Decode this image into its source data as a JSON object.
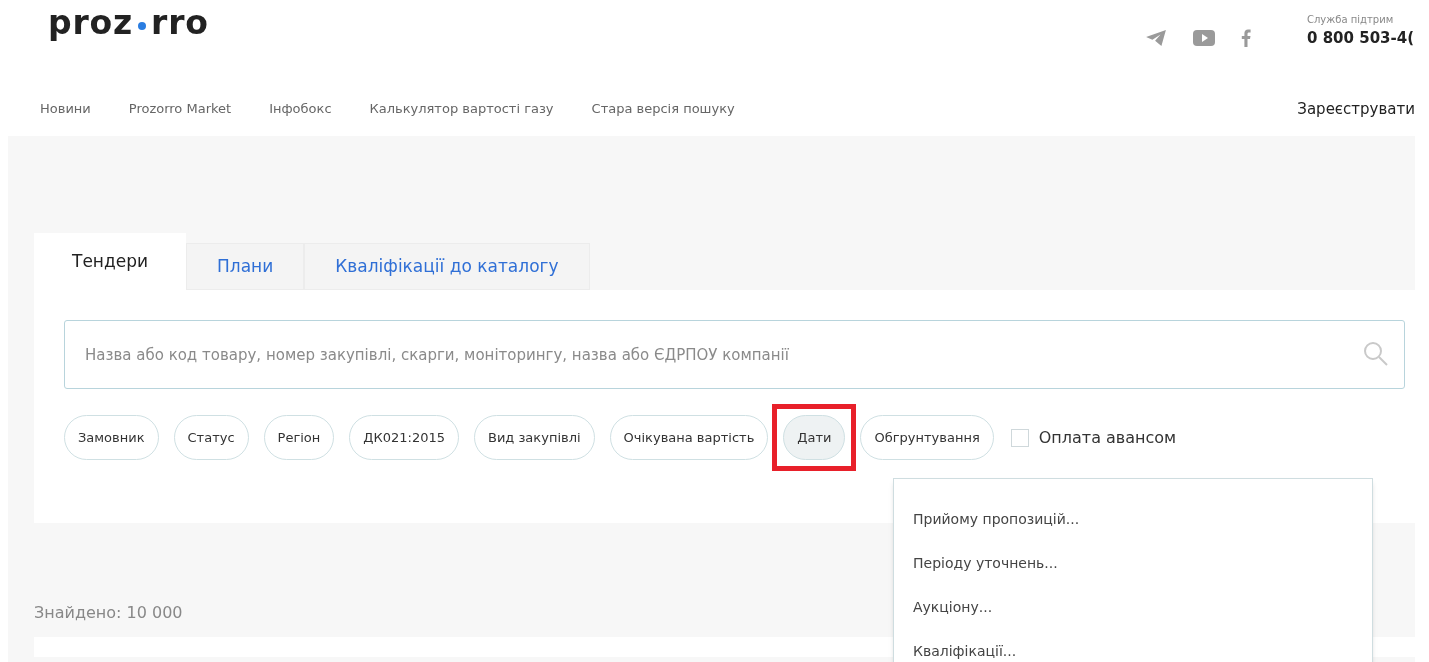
{
  "header": {
    "logo": [
      "proz",
      "rro"
    ],
    "support_label": "Служба підтрим",
    "support_phone": "0 800 503-4("
  },
  "nav": [
    "Новини",
    "Prozorro Market",
    "Інфобокс",
    "Калькулятор вартості газу",
    "Стара версія пошуку"
  ],
  "register_link": "Зареєструвати",
  "tabs": [
    {
      "label": "Тендери",
      "selected": true
    },
    {
      "label": "Плани",
      "selected": false
    },
    {
      "label": "Кваліфікації до каталогу",
      "selected": false
    }
  ],
  "search": {
    "placeholder": "Назва або код товару, номер закупівлі, скарги, моніторингу, назва або ЄДРПОУ компанії"
  },
  "filters": [
    {
      "label": "Замовник",
      "selected": false,
      "highlighted": false
    },
    {
      "label": "Статус",
      "selected": false,
      "highlighted": false
    },
    {
      "label": "Регіон",
      "selected": false,
      "highlighted": false
    },
    {
      "label": "ДК021:2015",
      "selected": false,
      "highlighted": false
    },
    {
      "label": "Вид закупівлі",
      "selected": false,
      "highlighted": false
    },
    {
      "label": "Очікувана вартість",
      "selected": false,
      "highlighted": false
    },
    {
      "label": "Дати",
      "selected": true,
      "highlighted": true
    },
    {
      "label": "Обгрунтування",
      "selected": false,
      "highlighted": false
    }
  ],
  "advance_payment": {
    "label": "Оплата авансом",
    "checked": false
  },
  "dates_menu": [
    "Прийому пропозицій...",
    "Періоду уточнень...",
    "Аукціону...",
    "Кваліфікації..."
  ],
  "results_count": "Знайдено: 10 000"
}
